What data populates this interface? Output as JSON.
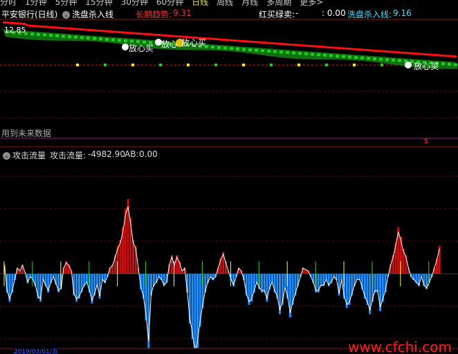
{
  "top_tabs": [
    "分时",
    "1分钟",
    "5分钟",
    "15分钟",
    "30分钟",
    "60分钟",
    "日线",
    "周线",
    "月线",
    "多周期",
    "更多>"
  ],
  "top_tabs_active": "日线",
  "main_panel": {
    "title": "平安银行(日线)",
    "indicator_name": "洗盘杀入线",
    "long_trend_label": "长期趋势:",
    "long_trend_value": "9.31",
    "red_buy_green_sell_label": "红买绿卖:",
    "red_buy_green_sell_value": "-",
    "value_b": ": 0.00",
    "wash_line_label": "洗盘杀入线:",
    "wash_line_value": "9.16",
    "price_marker": "12.85",
    "signals": [
      "放心买",
      "放心",
      "放心买",
      "放心买"
    ],
    "future_data_note": "用到未来数据",
    "dollar_marker": "$"
  },
  "sub_panel": {
    "title": "攻击流量",
    "attack_flow_label": "攻击流量:",
    "attack_flow_value": "-4982.90",
    "ab_label": "AB:",
    "ab_value": "0.00"
  },
  "bottom": {
    "date": "2019/03/01/五"
  },
  "watermark": "www.cfchi.com",
  "colors": {
    "up_bar": "#cc1010",
    "down_bar": "#1e8fff",
    "trend_line": "#ff1010",
    "wash_band": "#107010",
    "text_red": "#ff3030",
    "text_cyan": "#40e0ff"
  },
  "chart_data": {
    "type": "bar",
    "title": "攻击流量",
    "values": [
      30,
      -60,
      -90,
      -60,
      -20,
      20,
      10,
      30,
      5,
      -30,
      -10,
      -20,
      -40,
      -80,
      -90,
      -20,
      -40,
      -60,
      -30,
      -10,
      -35,
      -60,
      -50,
      20,
      40,
      30,
      10,
      -70,
      -90,
      -80,
      -60,
      -40,
      -30,
      -60,
      -95,
      -70,
      -40,
      -80,
      -20,
      -30,
      -10,
      20,
      30,
      60,
      90,
      110,
      150,
      210,
      240,
      180,
      110,
      90,
      20,
      -50,
      -80,
      -150,
      -240,
      -70,
      -40,
      -30,
      -10,
      -20,
      -40,
      -30,
      30,
      60,
      30,
      60,
      40,
      10,
      20,
      -60,
      -160,
      -210,
      -280,
      -240,
      -170,
      -110,
      -60,
      -30,
      -10,
      -20,
      -10,
      20,
      50,
      70,
      40,
      10,
      -20,
      -40,
      -10,
      20,
      10,
      -20,
      -70,
      -100,
      -90,
      -60,
      -30,
      -50,
      -60,
      -60,
      -90,
      -50,
      -30,
      -60,
      -80,
      -130,
      -100,
      -50,
      -80,
      -140,
      -100,
      -70,
      -40,
      -10,
      20,
      15,
      10,
      -10,
      -30,
      -60,
      -60,
      -40,
      -40,
      -20,
      -40,
      -30,
      -10,
      -20,
      -70,
      -20,
      -80,
      -110,
      -100,
      -70,
      -40,
      -20,
      -20,
      -50,
      -80,
      -100,
      -130,
      -90,
      -60,
      -60,
      -120,
      -90,
      -60,
      -10,
      30,
      60,
      100,
      150,
      120,
      80,
      60,
      20,
      -10,
      -20,
      -30,
      -40,
      -10,
      -40,
      -50,
      -30,
      -10,
      20,
      50,
      90
    ]
  }
}
